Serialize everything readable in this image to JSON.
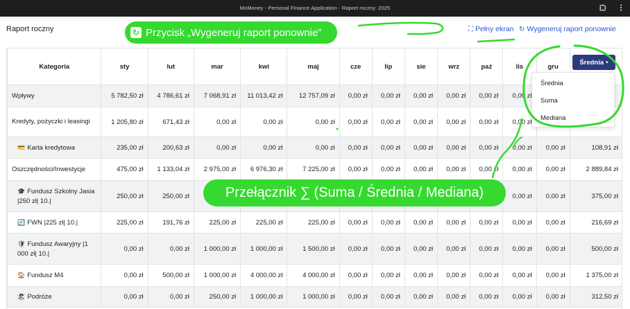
{
  "window": {
    "title": "MoMoney - Personal Finance Application - Raport roczny: 2025",
    "puzzle_icon": "puzzle-icon",
    "menu_icon": "kebab-menu-icon"
  },
  "header": {
    "page_title": "Raport roczny",
    "fullscreen_label": "Pełny ekran",
    "fullscreen_icon": "expand-icon",
    "regenerate_label": "Wygeneruj raport ponownie",
    "regenerate_icon": "refresh-icon"
  },
  "table": {
    "columns": [
      "Kategoria",
      "sty",
      "lut",
      "mar",
      "kwi",
      "maj",
      "cze",
      "lip",
      "sie",
      "wrz",
      "paź",
      "lis",
      "gru"
    ],
    "rows": [
      {
        "label": "Wpływy",
        "icon": "",
        "values": [
          "5 782,50 zł",
          "4 786,61 zł",
          "7 068,91 zł",
          "11 013,42 zł",
          "12 757,09 zł",
          "0,00 zł",
          "0,00 zł",
          "0,00 zł",
          "0,00 zł",
          "0,00 zł",
          "0,00 zł",
          "",
          ""
        ]
      },
      {
        "label": "Kredyty, pożyczki i leasingi",
        "icon": "",
        "values": [
          "1 205,80 zł",
          "671,43 zł",
          "0,00 zł",
          "0,00 zł",
          "0,00 zł",
          "0,00 zł",
          "0,00 zł",
          "0,00 zł",
          "0,00 zł",
          "0,00 zł",
          "0,00 zł",
          "",
          ""
        ]
      },
      {
        "label": "Karta kredytowa",
        "icon": "💳",
        "values": [
          "235,00 zł",
          "200,63 zł",
          "0,00 zł",
          "0,00 zł",
          "0,00 zł",
          "0,00 zł",
          "0,00 zł",
          "0,00 zł",
          "0,00 zł",
          "0,00 zł",
          "0,00 zł",
          "0,00 zł",
          "108,91 zł"
        ]
      },
      {
        "label": "Oszczędności/Inwestycje",
        "icon": "",
        "values": [
          "475,00 zł",
          "1 133,04 zł",
          "2 975,00 zł",
          "6 976,30 zł",
          "7 225,00 zł",
          "0,00 zł",
          "0,00 zł",
          "0,00 zł",
          "0,00 zł",
          "0,00 zł",
          "0,00 zł",
          "0,00 zł",
          "2 889,84 zł"
        ]
      },
      {
        "label": "Fundusz Szkolny Jasia |250 zł| 10.|",
        "icon": "🎓",
        "values": [
          "250,00 zł",
          "250,00 zł",
          "",
          "",
          "",
          "",
          "",
          "",
          "",
          "",
          "0,00 zł",
          "0,00 zł",
          "375,00 zł"
        ]
      },
      {
        "label": "FWN |225 zł| 10.|",
        "icon": "🔄",
        "values": [
          "225,00 zł",
          "191,76 zł",
          "225,00 zł",
          "225,00 zł",
          "225,00 zł",
          "0,00 zł",
          "0,00 zł",
          "0,00 zł",
          "0,00 zł",
          "0,00 zł",
          "0,00 zł",
          "0,00 zł",
          "216,69 zł"
        ]
      },
      {
        "label": "Fundusz Awaryjny |1 000 zł| 10.|",
        "icon": "🛡",
        "values": [
          "0,00 zł",
          "0,00 zł",
          "1 000,00 zł",
          "1 000,00 zł",
          "1 500,00 zł",
          "0,00 zł",
          "0,00 zł",
          "0,00 zł",
          "0,00 zł",
          "0,00 zł",
          "0,00 zł",
          "0,00 zł",
          "500,00 zł"
        ]
      },
      {
        "label": "Fundusz M4",
        "icon": "🏠",
        "values": [
          "0,00 zł",
          "500,00 zł",
          "1 000,00 zł",
          "4 000,00 zł",
          "4 000,00 zł",
          "0,00 zł",
          "0,00 zł",
          "0,00 zł",
          "0,00 zł",
          "0,00 zł",
          "0,00 zł",
          "0,00 zł",
          "1 375,00 zł"
        ]
      },
      {
        "label": "Podróże",
        "icon": "🏖",
        "values": [
          "0,00 zł",
          "0,00 zł",
          "250,00 zł",
          "1 000,00 zł",
          "1 000,00 zł",
          "0,00 zł",
          "0,00 zł",
          "0,00 zł",
          "0,00 zł",
          "0,00 zł",
          "0,00 zł",
          "0,00 zł",
          "312,50 zł"
        ]
      }
    ]
  },
  "aggregate": {
    "selected": "Średnia",
    "options": [
      "Średnia",
      "Suma",
      "Mediana"
    ]
  },
  "annotations": {
    "regenerate_note": "Przycisk „Wygeneruj raport ponownie”",
    "toggle_note": "Przełącznik ∑ (Suma / Średnia / Mediana)",
    "color": "#35d92f"
  },
  "colors": {
    "titlebar": "#1e1e1e",
    "link": "#2a55c8",
    "dropdown_button": "#2d3a7c",
    "row_shade": "#f1f2f4"
  }
}
